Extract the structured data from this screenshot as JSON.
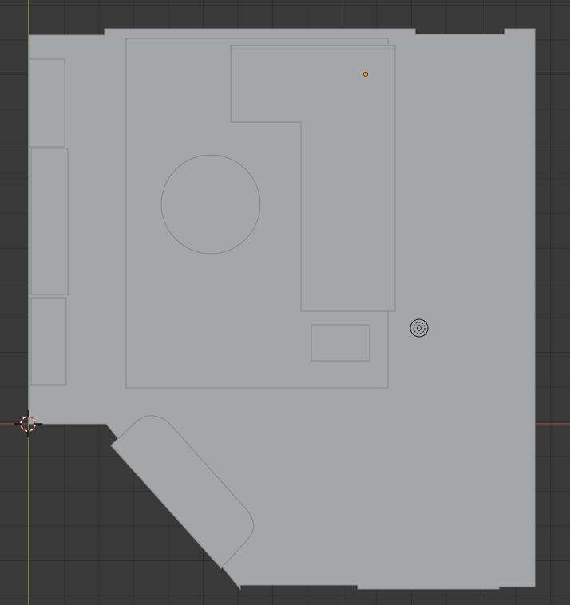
{
  "viewport": {
    "mode": "top-orthographic",
    "background_color": "#393939",
    "grid_color": "#2f2f2f",
    "x_axis_color": "#a14a4a",
    "y_axis_color": "#6c8c2c",
    "mesh_fill_color": "#a5a6a8",
    "mesh_edge_color": "#8a8b8d",
    "origin_point_color": "#f0a030"
  },
  "objects": [
    {
      "name": "floor-plane",
      "kind": "mesh"
    },
    {
      "name": "wall-cabinet-left-1",
      "kind": "mesh"
    },
    {
      "name": "wall-cabinet-left-2",
      "kind": "mesh"
    },
    {
      "name": "wall-cabinet-left-3",
      "kind": "mesh"
    },
    {
      "name": "rug-rectangle",
      "kind": "mesh"
    },
    {
      "name": "round-table",
      "kind": "mesh"
    },
    {
      "name": "l-shaped-sofa",
      "kind": "mesh"
    },
    {
      "name": "small-table",
      "kind": "mesh"
    },
    {
      "name": "angled-bench",
      "kind": "mesh"
    }
  ],
  "gizmos": {
    "cursor_3d": "3d-cursor-icon",
    "light": "light-empty-icon",
    "origin": "selected-origin-dot"
  }
}
